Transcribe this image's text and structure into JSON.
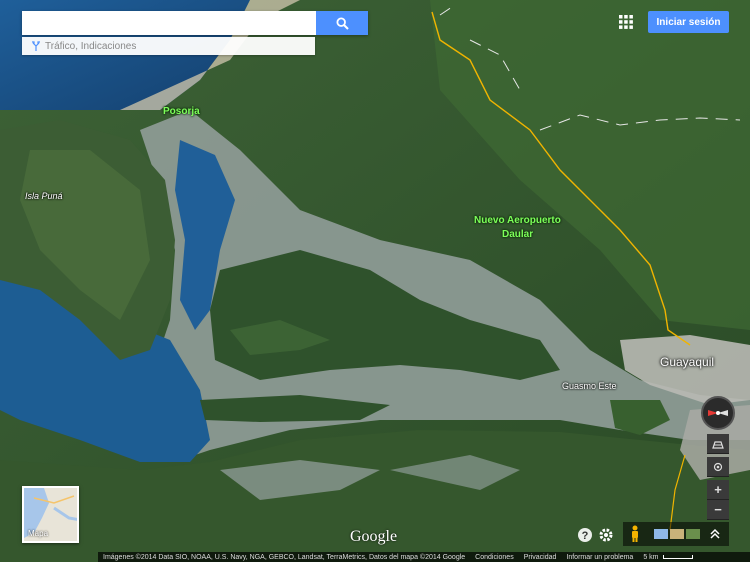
{
  "search": {
    "placeholder": "",
    "value": ""
  },
  "directions": {
    "label": "Tráfico, Indicaciones"
  },
  "header": {
    "signin_label": "Iniciar sesión"
  },
  "labels": {
    "posorja": "Posorja",
    "isla_puna": "Isla Puná",
    "aeropuerto_line1": "Nuevo Aeropuerto",
    "aeropuerto_line2": "Daular",
    "guayaquil": "Guayaquil",
    "guasmo_este": "Guasmo Este"
  },
  "minimap": {
    "label": "Mapa"
  },
  "brand": {
    "logo": "Google"
  },
  "footer": {
    "attribution": "Imágenes ©2014 Data SIO, NOAA, U.S. Navy, NGA, GEBCO, Landsat, TerraMetrics, Datos del mapa ©2014 Google",
    "terms": "Condiciones",
    "privacy": "Privacidad",
    "report": "Informar un problema",
    "scale": "5 km"
  },
  "colors": {
    "accent": "#4d90fe",
    "label_green": "#7dff5a",
    "road": "#f0b400"
  }
}
